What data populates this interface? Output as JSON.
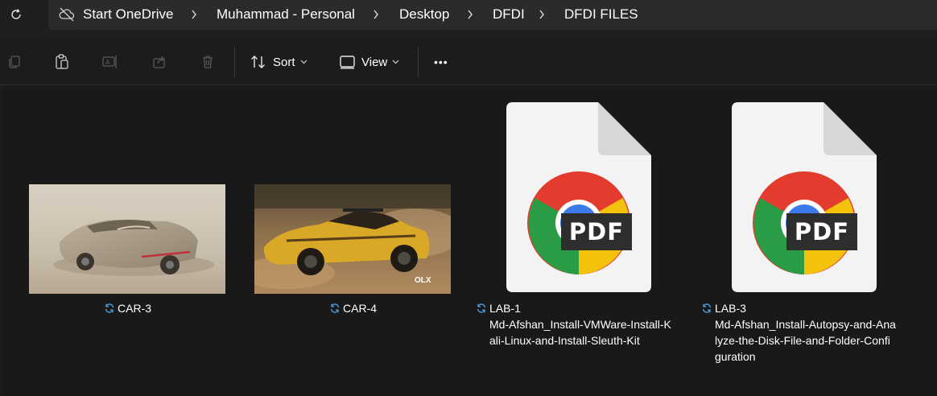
{
  "address_bar": {
    "breadcrumbs": [
      "Start OneDrive",
      "Muhammad - Personal",
      "Desktop",
      "DFDI",
      "DFDI FILES"
    ]
  },
  "command_bar": {
    "sort_label": "Sort",
    "view_label": "View",
    "more_label": "•••"
  },
  "files": [
    {
      "name": "CAR-3",
      "type": "image"
    },
    {
      "name": "CAR-4",
      "type": "image"
    },
    {
      "name": "LAB-1",
      "type": "pdf",
      "subtitle_lines": [
        "Md-Afshan_Install-VMWare-Install-K",
        "ali-Linux-and-Install-Sleuth-Kit"
      ]
    },
    {
      "name": "LAB-3",
      "type": "pdf",
      "subtitle_lines": [
        "Md-Afshan_Install-Autopsy-and-Ana",
        "lyze-the-Disk-File-and-Folder-Confi",
        "guration"
      ]
    }
  ],
  "pdf_badge": "PDF",
  "image_watermark": "OLX",
  "colors": {
    "accent": "#4cc2ff",
    "background": "#191919",
    "address_box": "#2b2b2b",
    "sync": "#4aa3e8"
  }
}
